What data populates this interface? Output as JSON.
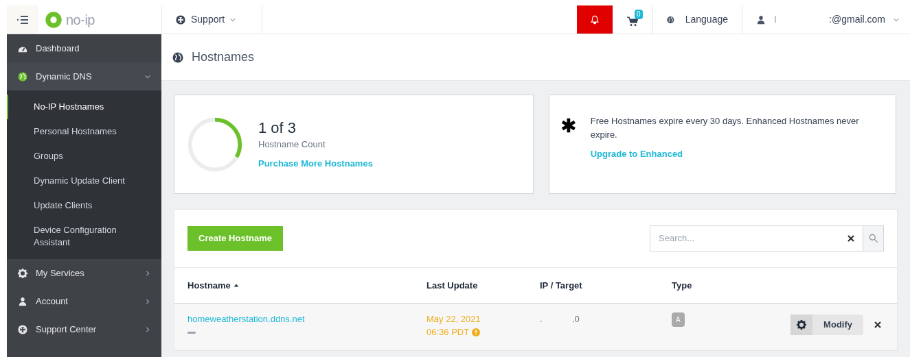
{
  "topbar": {
    "logo": "no-ip",
    "support": "Support",
    "notifications": {
      "active": true
    },
    "cart": {
      "count": "0"
    },
    "language": "Language",
    "user": {
      "name": "I",
      "email": ":@gmail.com"
    }
  },
  "sidebar": {
    "items": [
      {
        "label": "Dashboard"
      },
      {
        "label": "Dynamic DNS",
        "expanded": true,
        "has_arrow": true,
        "children": [
          {
            "label": "No-IP Hostnames",
            "selected": true
          },
          {
            "label": "Personal Hostnames",
            "selected": false
          },
          {
            "label": "Groups",
            "selected": false
          },
          {
            "label": "Dynamic Update Client",
            "selected": false
          },
          {
            "label": "Update Clients",
            "selected": false
          },
          {
            "label": "Device Configuration Assistant",
            "selected": false
          }
        ]
      },
      {
        "label": "My Services",
        "expanded": false,
        "has_arrow": true
      },
      {
        "label": "Account",
        "expanded": false,
        "has_arrow": true
      },
      {
        "label": "Support Center",
        "expanded": false,
        "has_arrow": true
      }
    ]
  },
  "page": {
    "title": "Hostnames"
  },
  "count_card": {
    "count": "1 of 3",
    "level": 0.333,
    "caption": "Hostname Count",
    "link": "Purchase More Hostnames"
  },
  "info_card": {
    "text": "Free Hostnames expire every 30 days. Enhanced Hostnames never expire.",
    "link": "Upgrade to Enhanced"
  },
  "toolbar": {
    "create_button": "Create Hostname",
    "search": {
      "placeholder": "Search..."
    }
  },
  "table": {
    "columns": [
      {
        "label": "Hostname",
        "sorted": true
      },
      {
        "label": "Last Update",
        "sorted": false
      },
      {
        "label": "IP / Target",
        "sorted": false
      },
      {
        "label": "Type",
        "sorted": false
      }
    ],
    "rows": [
      {
        "hostname": "homeweatherstation.ddns.net",
        "date": "May 22, 2021",
        "time": "06:36 PDT",
        "warning": true,
        "ip": ".            .0",
        "type": "A",
        "modify": "Modify"
      }
    ]
  }
}
